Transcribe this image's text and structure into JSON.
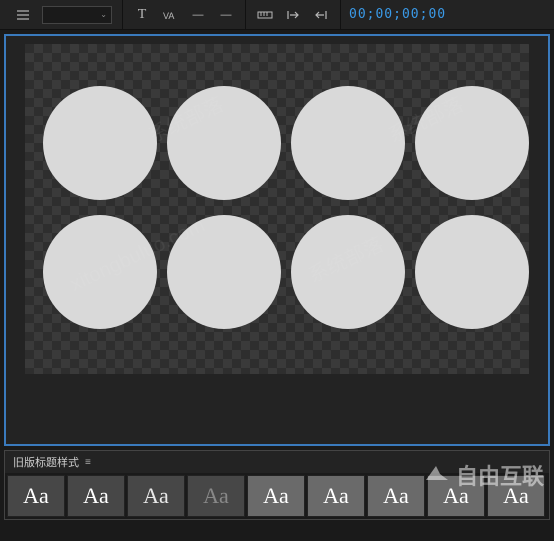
{
  "toolbar": {
    "timecode": "00;00;00;00"
  },
  "preview": {
    "circle_count": 8
  },
  "styles_panel": {
    "title": "旧版标题样式",
    "swatches": [
      "Aa",
      "Aa",
      "Aa",
      "Aa",
      "Aa",
      "Aa",
      "Aa",
      "Aa",
      "Aa"
    ]
  },
  "watermark": {
    "text_cn": "系统部落",
    "text_en": "xitongbuluo.com",
    "brand": "自由互联"
  }
}
